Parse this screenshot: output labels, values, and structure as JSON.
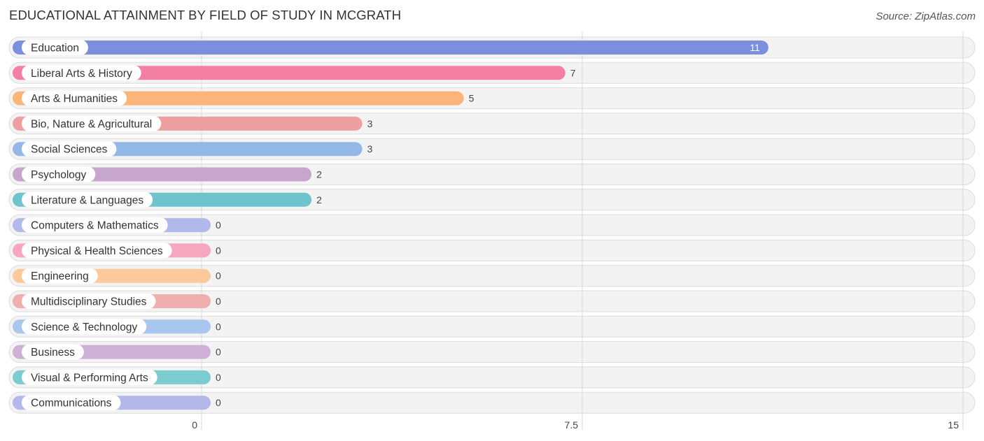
{
  "header": {
    "title": "EDUCATIONAL ATTAINMENT BY FIELD OF STUDY IN MCGRATH",
    "source": "Source: ZipAtlas.com"
  },
  "chart_data": {
    "type": "bar",
    "orientation": "horizontal",
    "title": "EDUCATIONAL ATTAINMENT BY FIELD OF STUDY IN MCGRATH",
    "xlabel": "",
    "ylabel": "",
    "xlim": [
      0,
      15
    ],
    "x_ticks": [
      0,
      7.5,
      15
    ],
    "x_tick_labels": [
      "0",
      "7.5",
      "15"
    ],
    "grid": true,
    "categories": [
      "Education",
      "Liberal Arts & History",
      "Arts & Humanities",
      "Bio, Nature & Agricultural",
      "Social Sciences",
      "Psychology",
      "Literature & Languages",
      "Computers & Mathematics",
      "Physical & Health Sciences",
      "Engineering",
      "Multidisciplinary Studies",
      "Science & Technology",
      "Business",
      "Visual & Performing Arts",
      "Communications"
    ],
    "values": [
      11,
      7,
      5,
      3,
      3,
      2,
      2,
      0,
      0,
      0,
      0,
      0,
      0,
      0,
      0
    ],
    "value_labels": [
      "11",
      "7",
      "5",
      "3",
      "3",
      "2",
      "2",
      "0",
      "0",
      "0",
      "0",
      "0",
      "0",
      "0",
      "0"
    ],
    "colors": [
      "#7b8fdf",
      "#f47fa4",
      "#fbb57a",
      "#eea0a0",
      "#93b8e6",
      "#c6a6cc",
      "#6ec4cc",
      "#b1b9ea",
      "#f7a6c0",
      "#fcc99c",
      "#f0aead",
      "#a9c6ee",
      "#cfb0d6",
      "#7ccbcf",
      "#b2b8ea"
    ]
  }
}
